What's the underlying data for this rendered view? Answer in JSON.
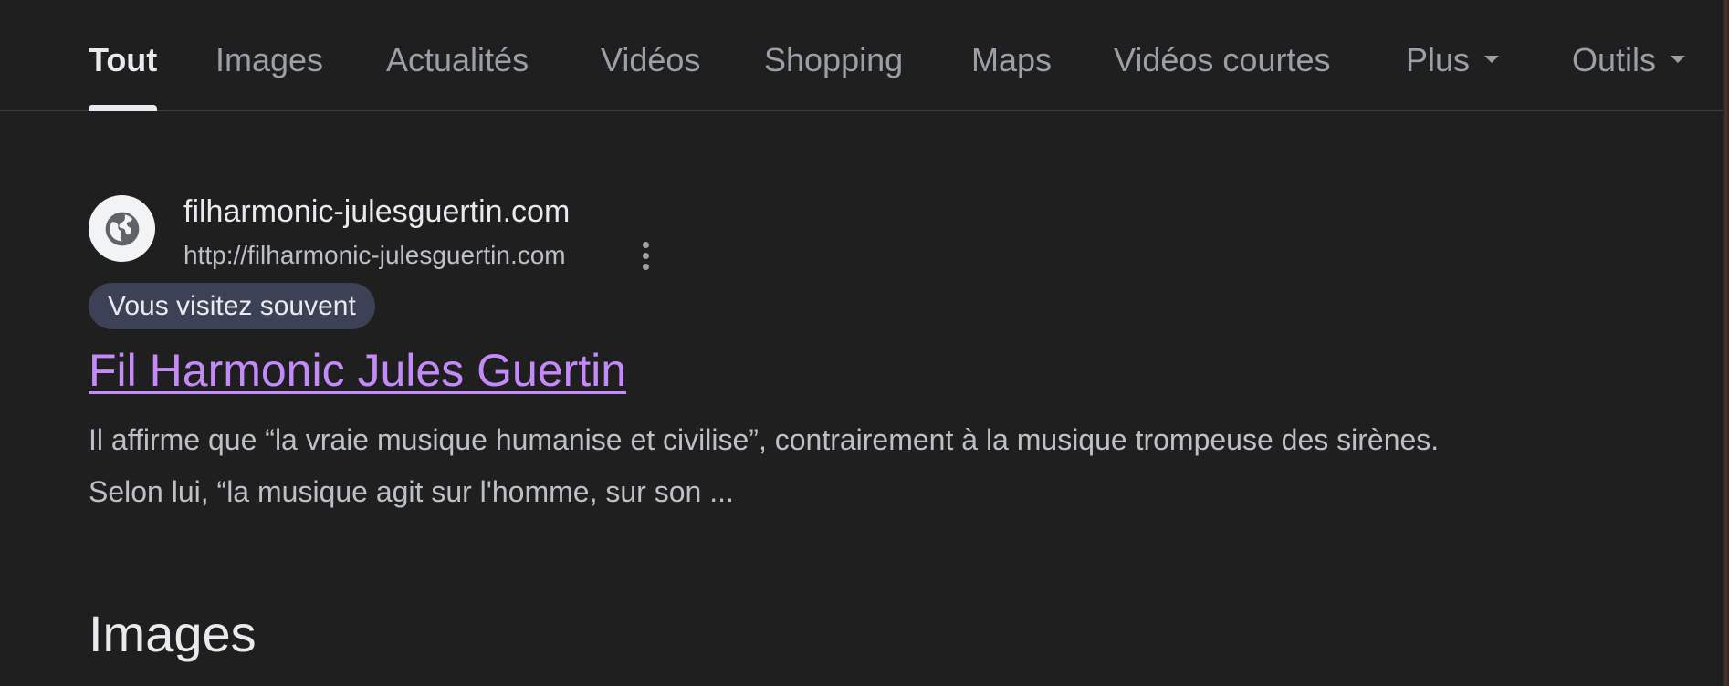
{
  "tabs": [
    {
      "label": "Tout",
      "active": true
    },
    {
      "label": "Images",
      "active": false
    },
    {
      "label": "Actualités",
      "active": false
    },
    {
      "label": "Vidéos",
      "active": false
    },
    {
      "label": "Shopping",
      "active": false
    },
    {
      "label": "Maps",
      "active": false
    },
    {
      "label": "Vidéos courtes",
      "active": false
    },
    {
      "label": "Plus",
      "active": false,
      "dropdown": true
    },
    {
      "label": "Outils",
      "active": false,
      "dropdown": true
    }
  ],
  "result": {
    "favicon_icon": "globe-icon",
    "site_name": "filharmonic-julesguertin.com",
    "site_url": "http://filharmonic-julesguertin.com",
    "badge": "Vous visitez souvent",
    "title": "Fil Harmonic Jules Guertin",
    "snippet_lines": [
      "Il affirme que “la vraie musique humanise et civilise”, contrairement à la musique trompeuse des sirènes.",
      "Selon lui, “la musique agit sur l'homme, sur son ..."
    ],
    "menu_icon": "more-vert-icon"
  },
  "images_section": {
    "heading": "Images"
  },
  "colors": {
    "background": "#1f1f1f",
    "visited_link": "#c58af9",
    "badge_bg": "#3c4155",
    "muted_text": "#9aa0a6"
  }
}
